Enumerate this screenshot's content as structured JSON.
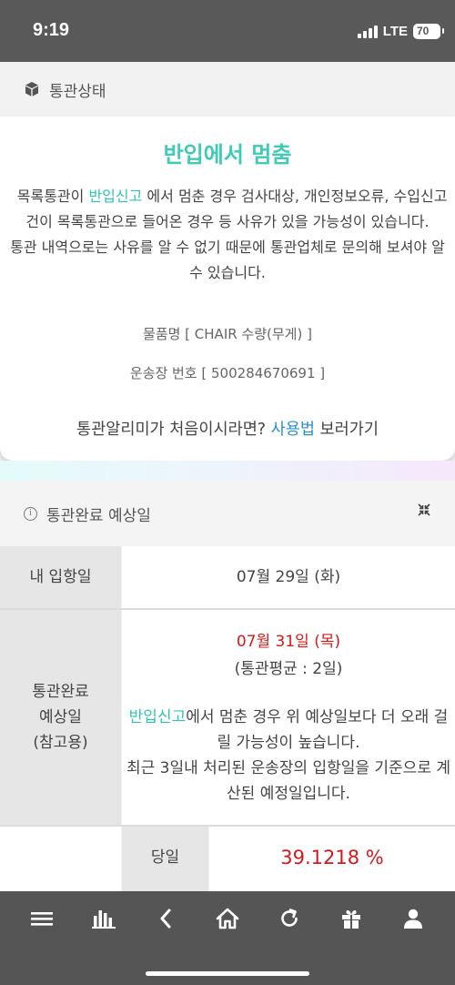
{
  "status_bar": {
    "time": "9:19",
    "network": "LTE",
    "battery": "70"
  },
  "customs_section": {
    "title": "통관상태",
    "icon": "cube-icon"
  },
  "status_card": {
    "title": "반입에서 멈춤",
    "desc_p1_prefix": "목록통관이 ",
    "desc_p1_link": "반입신고",
    "desc_p1_suffix": " 에서 멈춘 경우 검사대상, 개인정보오류, 수입신고건이 목록통관으로 들어온 경우 등 사유가 있을 가능성이 있습니다.",
    "desc_p2": "통관 내역으로는 사유를 알 수 없기 때문에 통관업체로 문의해 보셔야 알 수 있습니다.",
    "item_name": "물품명 [ CHAIR 수량(무게) ]",
    "waybill": "운송장 번호 [ 500284670691 ]",
    "guide_prefix": "통관알리미가 처음이시라면? ",
    "guide_link": "사용법",
    "guide_suffix": " 보러가기"
  },
  "eta_section": {
    "title": "통관완료 예상일",
    "rows": {
      "arrival_label": "내 입항일",
      "arrival_value": "07월 29일 (화)",
      "eta_label_l1": "통관완료",
      "eta_label_l2": "예상일",
      "eta_label_l3": "(참고용)",
      "eta_date": "07월 31일 (목)",
      "eta_avg": "(통관평균 : 2일)",
      "eta_note_link": "반입신고",
      "eta_note_rest": "에서 멈춘 경우 위 예상일보다 더 오래 걸릴 가능성이 높습니다.",
      "eta_note2": "최근 3일내 처리된 운송장의 입항일을 기준으로 계산된 예정일입니다.",
      "same_day_label": "당일",
      "same_day_value": "39.1218 %"
    }
  },
  "bottom_nav": {
    "items": [
      "menu-icon",
      "chart-icon",
      "back-icon",
      "home-icon",
      "refresh-icon",
      "gift-icon",
      "user-icon"
    ]
  },
  "colors": {
    "accent": "#3fcbb8",
    "link_blue": "#2a8fcf",
    "red": "#d21a1a",
    "nav_bg": "#555555"
  }
}
